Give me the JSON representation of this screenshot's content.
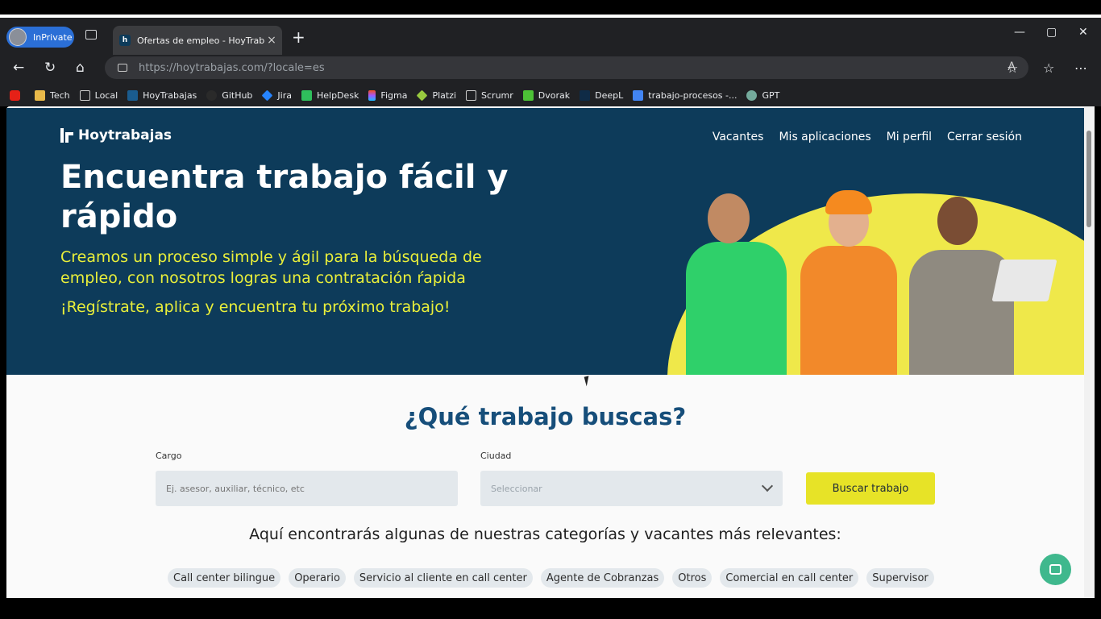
{
  "browser": {
    "profile_label": "InPrivate",
    "tab_title": "Ofertas de empleo - HoyTrabajas",
    "url_host": "https://hoytrabajas.com",
    "url_path": "/?locale=es",
    "bookmarks": [
      "Tech",
      "Local",
      "HoyTrabajas",
      "GitHub",
      "Jira",
      "HelpDesk",
      "Figma",
      "Platzi",
      "Scrumr",
      "Dvorak",
      "DeepL",
      "trabajo-procesos -...",
      "GPT"
    ]
  },
  "site": {
    "brand": "Hoytrabajas",
    "nav": [
      "Vacantes",
      "Mis aplicaciones",
      "Mi perfil",
      "Cerrar sesión"
    ],
    "hero_title": "Encuentra trabajo fácil y rápido",
    "hero_text": "Creamos un proceso simple y ágil para la búsqueda de empleo, con nosotros logras una contratación ŕapida",
    "hero_cta": "¡Regístrate, aplica y encuentra tu próximo trabajo!"
  },
  "search": {
    "title": "¿Qué trabajo buscas?",
    "cargo_label": "Cargo",
    "cargo_placeholder": "Ej. asesor, auxiliar, técnico, etc",
    "ciudad_label": "Ciudad",
    "ciudad_value": "Seleccionar",
    "button_label": "Buscar trabajo",
    "categories_heading": "Aquí encontrarás algunas de nuestras categorías y vacantes más relevantes:",
    "categories": [
      "Call center bilingue",
      "Operario",
      "Servicio al cliente en call center",
      "Agente de Cobranzas",
      "Otros",
      "Comercial en call center",
      "Supervisor"
    ]
  },
  "colors": {
    "hero_bg": "#0d3b5a",
    "accent_yellow": "#e7e327",
    "title_blue": "#164e7a",
    "chat_green": "#3fb88d"
  }
}
